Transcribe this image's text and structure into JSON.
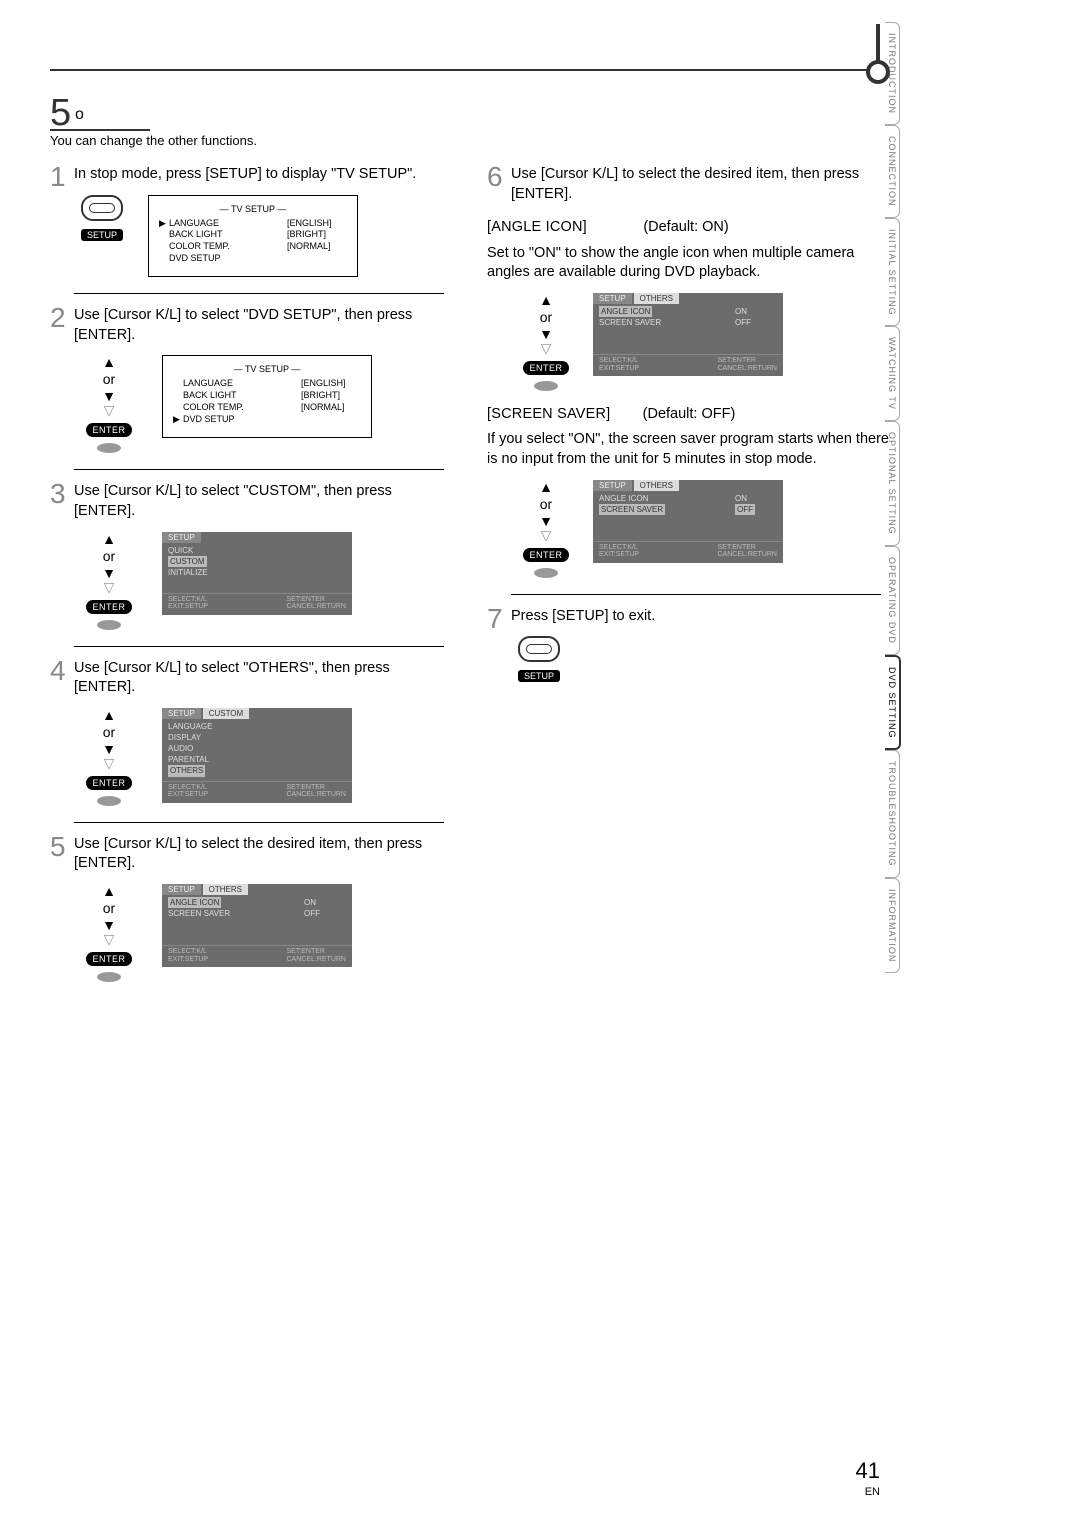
{
  "header": {
    "section_number": "5",
    "section_symbol": "o",
    "subtitle": "You can change the other functions."
  },
  "tabs": [
    {
      "label": "INTRODUCTION",
      "active": false
    },
    {
      "label": "CONNECTION",
      "active": false
    },
    {
      "label": "INITIAL SETTING",
      "active": false
    },
    {
      "label": "WATCHING TV",
      "active": false
    },
    {
      "label": "OPTIONAL SETTING",
      "active": false
    },
    {
      "label": "OPERATING DVD",
      "active": false
    },
    {
      "label": "DVD SETTING",
      "active": true
    },
    {
      "label": "TROUBLESHOOTING",
      "active": false
    },
    {
      "label": "INFORMATION",
      "active": false
    }
  ],
  "common": {
    "or": "or",
    "enter": "ENTER",
    "setup_label": "SETUP",
    "select_hint_l": "SELECT:K/L",
    "select_hint_r": "SET:ENTER",
    "exit_hint_l": "EXIT:SETUP",
    "exit_hint_r": "CANCEL:RETURN"
  },
  "steps": {
    "s1": {
      "num": "1",
      "text": "In stop mode, press [SETUP] to display \"TV SETUP\".",
      "screen_title": "— TV SETUP —",
      "rows": [
        {
          "arrow": "▶",
          "label": "LANGUAGE",
          "value": "[ENGLISH]"
        },
        {
          "arrow": "",
          "label": "BACK LIGHT",
          "value": "[BRIGHT]"
        },
        {
          "arrow": "",
          "label": "COLOR TEMP.",
          "value": "[NORMAL]"
        },
        {
          "arrow": "",
          "label": "DVD SETUP",
          "value": ""
        }
      ]
    },
    "s2": {
      "num": "2",
      "text": "Use [Cursor K/L] to select \"DVD SETUP\", then press [ENTER].",
      "screen_title": "— TV SETUP —",
      "rows": [
        {
          "arrow": "",
          "label": "LANGUAGE",
          "value": "[ENGLISH]"
        },
        {
          "arrow": "",
          "label": "BACK LIGHT",
          "value": "[BRIGHT]"
        },
        {
          "arrow": "",
          "label": "COLOR TEMP.",
          "value": "[NORMAL]"
        },
        {
          "arrow": "▶",
          "label": "DVD SETUP",
          "value": ""
        }
      ]
    },
    "s3": {
      "num": "3",
      "text": "Use [Cursor K/L] to select \"CUSTOM\", then press [ENTER].",
      "tab": "SETUP",
      "items": [
        "QUICK",
        "CUSTOM",
        "INITIALIZE"
      ],
      "highlight": "CUSTOM"
    },
    "s4": {
      "num": "4",
      "text": "Use [Cursor K/L] to select \"OTHERS\", then press [ENTER].",
      "tab1": "SETUP",
      "tab2": "CUSTOM",
      "items": [
        "LANGUAGE",
        "DISPLAY",
        "AUDIO",
        "PARENTAL",
        "OTHERS"
      ],
      "highlight": "OTHERS"
    },
    "s5": {
      "num": "5",
      "text": "Use [Cursor K/L] to select the desired item, then press [ENTER].",
      "tab1": "SETUP",
      "tab2": "OTHERS",
      "rows": [
        {
          "k": "ANGLE ICON",
          "v": "ON",
          "hi": true
        },
        {
          "k": "SCREEN SAVER",
          "v": "OFF",
          "hi": false
        }
      ]
    },
    "s6": {
      "num": "6",
      "text": "Use [Cursor K/L] to select the desired item, then press [ENTER].",
      "angle_label": "[ANGLE ICON]",
      "angle_default": "(Default: ON)",
      "angle_desc": "Set to \"ON\" to show the angle icon when multiple camera angles are available during DVD playback.",
      "angle_rows": [
        {
          "k": "ANGLE ICON",
          "v": "ON",
          "hi": true
        },
        {
          "k": "SCREEN SAVER",
          "v": "OFF",
          "hi": false
        }
      ],
      "ss_label": "[SCREEN SAVER]",
      "ss_default": "(Default: OFF)",
      "ss_desc": "If you select \"ON\", the screen saver program starts when there is no input from the unit for 5 minutes in stop mode.",
      "ss_rows": [
        {
          "k": "ANGLE ICON",
          "v": "ON",
          "hi": false
        },
        {
          "k": "SCREEN SAVER",
          "v": "OFF",
          "hi": true
        }
      ],
      "tab1": "SETUP",
      "tab2": "OTHERS"
    },
    "s7": {
      "num": "7",
      "text": "Press [SETUP] to exit."
    }
  },
  "footer": {
    "page": "41",
    "lang": "EN"
  }
}
